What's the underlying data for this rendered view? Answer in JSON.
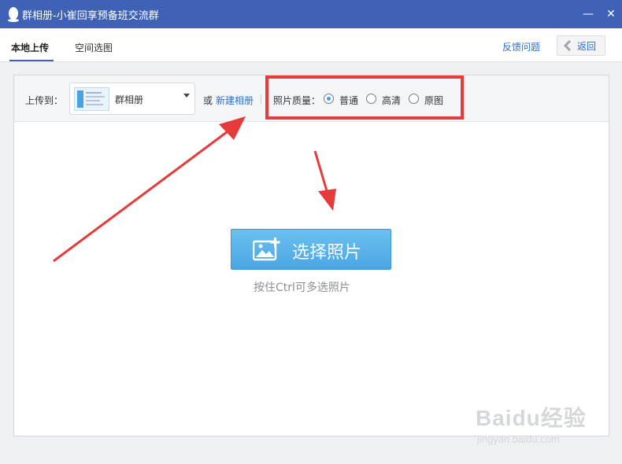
{
  "window": {
    "title": "群相册-小崔回享预备班交流群",
    "minimize_symbol": "—",
    "close_symbol": "✕"
  },
  "tabs": {
    "local_upload": "本地上传",
    "space_pick": "空间选图"
  },
  "header": {
    "feedback": "反馈问题",
    "back": "返回"
  },
  "toolbar": {
    "upload_to_label": "上传到：",
    "album_name": "群相册",
    "or_text": "或",
    "new_album": "新建相册",
    "quality_label": "照片质量：",
    "quality_options": [
      {
        "label": "普通",
        "checked": true
      },
      {
        "label": "高清",
        "checked": false
      },
      {
        "label": "原图",
        "checked": false
      }
    ]
  },
  "main": {
    "choose_button": "选择照片",
    "hint": "按住Ctrl可多选照片"
  },
  "watermark": {
    "brand": "Baidu经验",
    "url": "jingyan.baidu.com"
  },
  "colors": {
    "titlebar": "#3f62b6",
    "button": "#49a6e3",
    "link": "#2e6fbf",
    "annotation": "#e63b3b"
  },
  "icons": [
    "qq-penguin-icon",
    "minimize-icon",
    "close-icon",
    "chevron-left-icon",
    "dropdown-caret-icon",
    "add-photo-icon"
  ]
}
